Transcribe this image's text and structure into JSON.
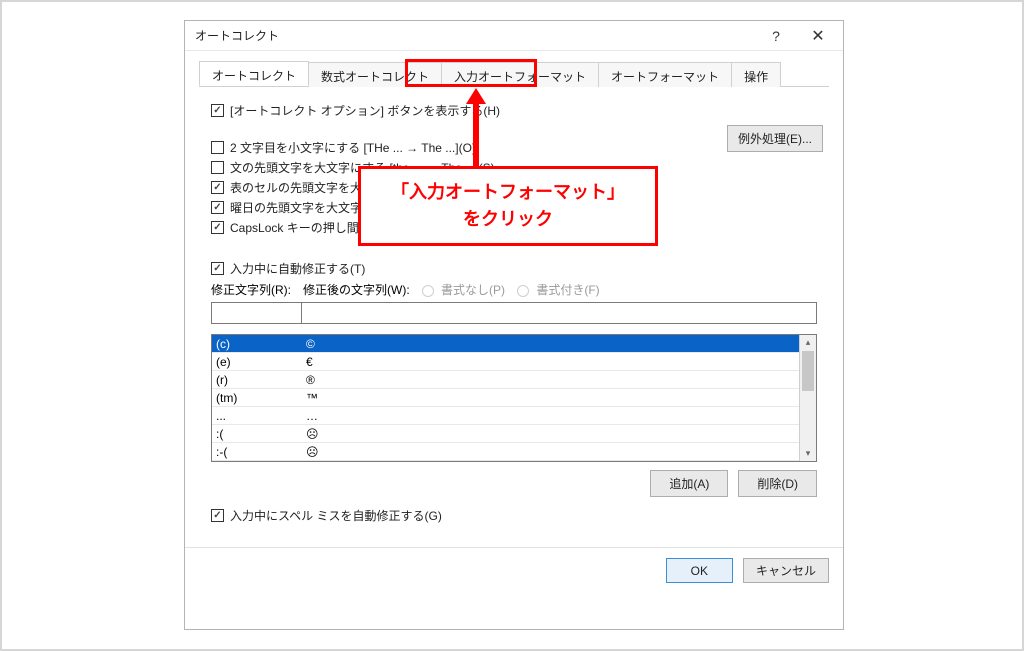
{
  "titlebar": {
    "title": "オートコレクト",
    "help_label": "?",
    "close_label": "✕"
  },
  "tabs": {
    "t0": "オートコレクト",
    "t1": "数式オートコレクト",
    "t2": "入力オートフォーマット",
    "t3": "オートフォーマット",
    "t4": "操作"
  },
  "checks": {
    "show_options": "[オートコレクト オプション] ボタンを表示する(H)",
    "cap2": "2 文字目を小文字にする [THe ... → The ...](O)",
    "capsent": "文の先頭文字を大文字にする [the ... → The ...](S)",
    "capcell": "表のセルの先頭文字を大文字にする(C)",
    "capday": "曜日の先頭文字を大文字にする [monday → Monday](N)",
    "capslock": "CapsLock キーの押し間違いを修正する [tHE ... → The ...](L)",
    "replace": "入力中に自動修正する(T)",
    "spell": "入力中にスペル ミスを自動修正する(G)"
  },
  "labels": {
    "replace_col": "修正文字列(R):",
    "with_col": "修正後の文字列(W):",
    "plain": "書式なし(P)",
    "formatted": "書式付き(F)"
  },
  "buttons": {
    "exceptions": "例外処理(E)...",
    "add": "追加(A)",
    "delete": "削除(D)",
    "ok": "OK",
    "cancel": "キャンセル"
  },
  "list": [
    {
      "from": "(c)",
      "to": "©"
    },
    {
      "from": "(e)",
      "to": "€"
    },
    {
      "from": "(r)",
      "to": "®"
    },
    {
      "from": "(tm)",
      "to": "™"
    },
    {
      "from": "...",
      "to": "…"
    },
    {
      "from": ":(",
      "to": "☹"
    },
    {
      "from": ":-(",
      "to": "☹"
    }
  ],
  "callout": {
    "text1": "「入力オートフォーマット」",
    "text2": "をクリック"
  }
}
